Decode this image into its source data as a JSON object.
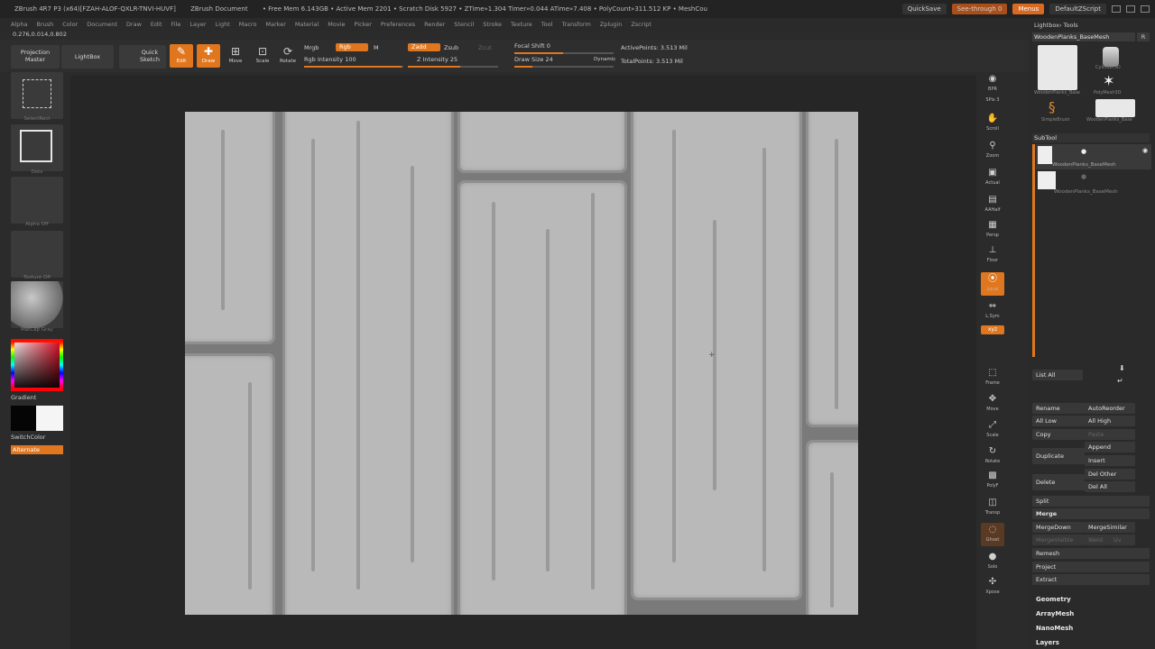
{
  "title_bar": {
    "app_title": "ZBrush 4R7 P3 (x64)[FZAH-ALOF-QXLR-TNVI-HUVF]",
    "document": "ZBrush Document",
    "free_mem": "• Free Mem 6.143GB",
    "active_mem": "• Active Mem 2201",
    "scratch_disk": "• Scratch Disk 5927",
    "ztime": "• ZTime»1.304",
    "timer": "Timer»0.044",
    "atime": "ATime»7.408",
    "polycount": "• PolyCount»311.512 KP",
    "meshcount": "• MeshCou",
    "quicksave": "QuickSave",
    "see_through": "See-through 0",
    "menus": "Menus",
    "default_zscript": "DefaultZScript"
  },
  "menubar": {
    "items": [
      "Alpha",
      "Brush",
      "Color",
      "Document",
      "Draw",
      "Edit",
      "File",
      "Layer",
      "Light",
      "Macro",
      "Marker",
      "Material",
      "Movie",
      "Picker",
      "Preferences",
      "Render",
      "Stencil",
      "Stroke",
      "Texture",
      "Tool",
      "Transform",
      "Zplugin",
      "Zscript"
    ]
  },
  "coords": "0.276,0.014,0.802",
  "toolbar": {
    "projection_master": "Projection Master",
    "lightbox": "LightBox",
    "quick_sketch": "Quick Sketch",
    "edit": "Edit",
    "draw": "Draw",
    "move": "Move",
    "scale": "Scale",
    "rotate": "Rotate",
    "mrgb": "Mrgb",
    "rgb": "Rgb",
    "m": "M",
    "rgb_intensity": "Rgb Intensity 100",
    "zadd": "Zadd",
    "zsub": "Zsub",
    "zcut": "Zcut",
    "z_intensity": "Z Intensity 25",
    "focal_shift": "Focal Shift 0",
    "draw_size": "Draw Size 24",
    "dynamic": "Dynamic",
    "active_points": "ActivePoints: 3.513 Mil",
    "total_points": "TotalPoints: 3.513 Mil"
  },
  "left_shelf": {
    "select_rect": "SelectRect",
    "dots": "Dots",
    "alpha_off": "Alpha Off",
    "texture_off": "Texture Off",
    "material": "MatCap Gray",
    "gradient": "Gradient",
    "switch_color": "SwitchColor",
    "alternate": "Alternate"
  },
  "right_vertical": {
    "items": [
      {
        "name": "bpr",
        "label": "BPR"
      },
      {
        "name": "spix",
        "label": "SPix 3"
      },
      {
        "name": "scroll",
        "label": "Scroll"
      },
      {
        "name": "zoom",
        "label": "Zoom"
      },
      {
        "name": "actual",
        "label": "Actual"
      },
      {
        "name": "aahalf",
        "label": "AAHalf"
      },
      {
        "name": "persp",
        "label": "Persp"
      },
      {
        "name": "floor",
        "label": "Floor"
      },
      {
        "name": "local",
        "label": "Local"
      },
      {
        "name": "lsym",
        "label": "L.Sym"
      },
      {
        "name": "xyz",
        "label": "xyz"
      },
      {
        "name": "frame",
        "label": "Frame"
      },
      {
        "name": "move",
        "label": "Move"
      },
      {
        "name": "scale",
        "label": "Scale"
      },
      {
        "name": "rotate",
        "label": "Rotate"
      },
      {
        "name": "polyf",
        "label": "PolyF"
      },
      {
        "name": "transp",
        "label": "Transp"
      },
      {
        "name": "ghost",
        "label": "Ghost"
      },
      {
        "name": "solo",
        "label": "Solo"
      },
      {
        "name": "xpose",
        "label": "Xpose"
      }
    ]
  },
  "right_panel": {
    "lightbox_tools": "Lightbox› Tools",
    "tool_name": "WoodenPlanks_BaseMesh",
    "r_label": "R",
    "thumbs": {
      "wooden": "WoodenPlanks_Base",
      "cylinder": "Cylinder3D",
      "polymesh": "PolyMesh3D",
      "simplebrush": "SimpleBrush",
      "wooden2": "WoodenPlanks_Base"
    },
    "subtool": "SubTool",
    "subtool_items": [
      "WoodenPlanks_BaseMesh",
      "WoodenPlanks_BaseMesh"
    ],
    "list_all": "List All",
    "rename": "Rename",
    "auto_reorder": "AutoReorder",
    "all_low": "All Low",
    "all_high": "All High",
    "copy": "Copy",
    "paste": "Paste",
    "duplicate": "Duplicate",
    "append": "Append",
    "insert": "Insert",
    "delete": "Delete",
    "del_other": "Del Other",
    "del_all": "Del All",
    "split": "Split",
    "merge": "Merge",
    "merge_down": "MergeDown",
    "merge_similar": "MergeSimilar",
    "merge_visible": "MergeVisible",
    "weld": "Weld",
    "uv": "Uv",
    "remesh": "Remesh",
    "project": "Project",
    "extract": "Extract",
    "geometry": "Geometry",
    "arraymesh": "ArrayMesh",
    "nanomesh": "NanoMesh",
    "layers": "Layers"
  },
  "colors": {
    "accent": "#e0771f",
    "bg": "#2b2b2b",
    "canvas": "#b8b8b8"
  }
}
